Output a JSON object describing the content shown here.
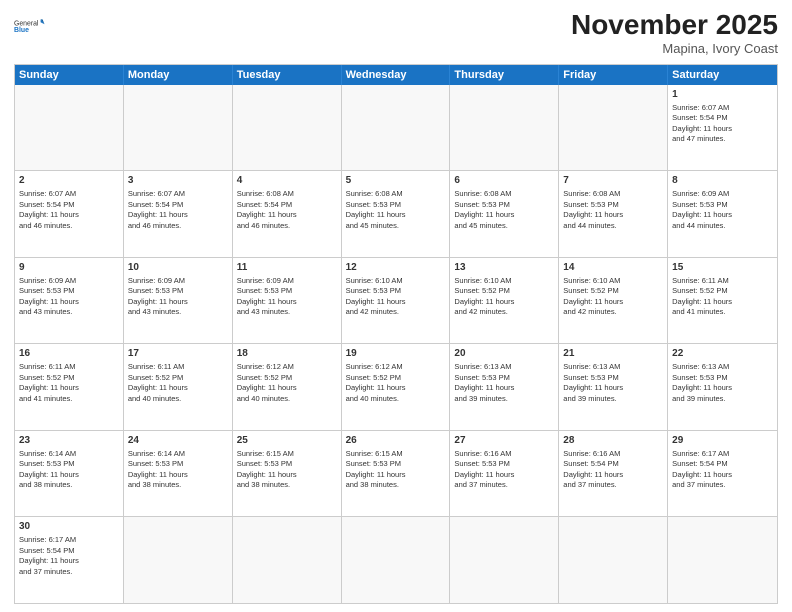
{
  "header": {
    "logo_line1": "General",
    "logo_line2": "Blue",
    "month": "November 2025",
    "location": "Mapina, Ivory Coast"
  },
  "weekdays": [
    "Sunday",
    "Monday",
    "Tuesday",
    "Wednesday",
    "Thursday",
    "Friday",
    "Saturday"
  ],
  "rows": [
    [
      {
        "day": "",
        "info": ""
      },
      {
        "day": "",
        "info": ""
      },
      {
        "day": "",
        "info": ""
      },
      {
        "day": "",
        "info": ""
      },
      {
        "day": "",
        "info": ""
      },
      {
        "day": "",
        "info": ""
      },
      {
        "day": "1",
        "info": "Sunrise: 6:07 AM\nSunset: 5:54 PM\nDaylight: 11 hours\nand 47 minutes."
      }
    ],
    [
      {
        "day": "2",
        "info": "Sunrise: 6:07 AM\nSunset: 5:54 PM\nDaylight: 11 hours\nand 46 minutes."
      },
      {
        "day": "3",
        "info": "Sunrise: 6:07 AM\nSunset: 5:54 PM\nDaylight: 11 hours\nand 46 minutes."
      },
      {
        "day": "4",
        "info": "Sunrise: 6:08 AM\nSunset: 5:54 PM\nDaylight: 11 hours\nand 46 minutes."
      },
      {
        "day": "5",
        "info": "Sunrise: 6:08 AM\nSunset: 5:53 PM\nDaylight: 11 hours\nand 45 minutes."
      },
      {
        "day": "6",
        "info": "Sunrise: 6:08 AM\nSunset: 5:53 PM\nDaylight: 11 hours\nand 45 minutes."
      },
      {
        "day": "7",
        "info": "Sunrise: 6:08 AM\nSunset: 5:53 PM\nDaylight: 11 hours\nand 44 minutes."
      },
      {
        "day": "8",
        "info": "Sunrise: 6:09 AM\nSunset: 5:53 PM\nDaylight: 11 hours\nand 44 minutes."
      }
    ],
    [
      {
        "day": "9",
        "info": "Sunrise: 6:09 AM\nSunset: 5:53 PM\nDaylight: 11 hours\nand 43 minutes."
      },
      {
        "day": "10",
        "info": "Sunrise: 6:09 AM\nSunset: 5:53 PM\nDaylight: 11 hours\nand 43 minutes."
      },
      {
        "day": "11",
        "info": "Sunrise: 6:09 AM\nSunset: 5:53 PM\nDaylight: 11 hours\nand 43 minutes."
      },
      {
        "day": "12",
        "info": "Sunrise: 6:10 AM\nSunset: 5:53 PM\nDaylight: 11 hours\nand 42 minutes."
      },
      {
        "day": "13",
        "info": "Sunrise: 6:10 AM\nSunset: 5:52 PM\nDaylight: 11 hours\nand 42 minutes."
      },
      {
        "day": "14",
        "info": "Sunrise: 6:10 AM\nSunset: 5:52 PM\nDaylight: 11 hours\nand 42 minutes."
      },
      {
        "day": "15",
        "info": "Sunrise: 6:11 AM\nSunset: 5:52 PM\nDaylight: 11 hours\nand 41 minutes."
      }
    ],
    [
      {
        "day": "16",
        "info": "Sunrise: 6:11 AM\nSunset: 5:52 PM\nDaylight: 11 hours\nand 41 minutes."
      },
      {
        "day": "17",
        "info": "Sunrise: 6:11 AM\nSunset: 5:52 PM\nDaylight: 11 hours\nand 40 minutes."
      },
      {
        "day": "18",
        "info": "Sunrise: 6:12 AM\nSunset: 5:52 PM\nDaylight: 11 hours\nand 40 minutes."
      },
      {
        "day": "19",
        "info": "Sunrise: 6:12 AM\nSunset: 5:52 PM\nDaylight: 11 hours\nand 40 minutes."
      },
      {
        "day": "20",
        "info": "Sunrise: 6:13 AM\nSunset: 5:53 PM\nDaylight: 11 hours\nand 39 minutes."
      },
      {
        "day": "21",
        "info": "Sunrise: 6:13 AM\nSunset: 5:53 PM\nDaylight: 11 hours\nand 39 minutes."
      },
      {
        "day": "22",
        "info": "Sunrise: 6:13 AM\nSunset: 5:53 PM\nDaylight: 11 hours\nand 39 minutes."
      }
    ],
    [
      {
        "day": "23",
        "info": "Sunrise: 6:14 AM\nSunset: 5:53 PM\nDaylight: 11 hours\nand 38 minutes."
      },
      {
        "day": "24",
        "info": "Sunrise: 6:14 AM\nSunset: 5:53 PM\nDaylight: 11 hours\nand 38 minutes."
      },
      {
        "day": "25",
        "info": "Sunrise: 6:15 AM\nSunset: 5:53 PM\nDaylight: 11 hours\nand 38 minutes."
      },
      {
        "day": "26",
        "info": "Sunrise: 6:15 AM\nSunset: 5:53 PM\nDaylight: 11 hours\nand 38 minutes."
      },
      {
        "day": "27",
        "info": "Sunrise: 6:16 AM\nSunset: 5:53 PM\nDaylight: 11 hours\nand 37 minutes."
      },
      {
        "day": "28",
        "info": "Sunrise: 6:16 AM\nSunset: 5:54 PM\nDaylight: 11 hours\nand 37 minutes."
      },
      {
        "day": "29",
        "info": "Sunrise: 6:17 AM\nSunset: 5:54 PM\nDaylight: 11 hours\nand 37 minutes."
      }
    ],
    [
      {
        "day": "30",
        "info": "Sunrise: 6:17 AM\nSunset: 5:54 PM\nDaylight: 11 hours\nand 37 minutes."
      },
      {
        "day": "",
        "info": ""
      },
      {
        "day": "",
        "info": ""
      },
      {
        "day": "",
        "info": ""
      },
      {
        "day": "",
        "info": ""
      },
      {
        "day": "",
        "info": ""
      },
      {
        "day": "",
        "info": ""
      }
    ]
  ]
}
